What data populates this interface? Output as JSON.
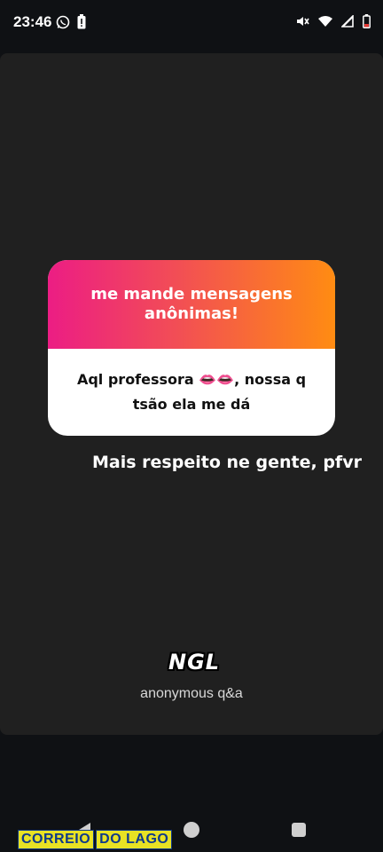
{
  "status_bar": {
    "time": "23:46",
    "left_icons": [
      "whatsapp-icon",
      "battery-alert-icon"
    ],
    "right_icons": [
      "mute-icon",
      "wifi-icon",
      "signal-icon",
      "battery-icon"
    ]
  },
  "story": {
    "card": {
      "header": "me mande mensagens anônimas!",
      "message": "Aql professora 👄👄, nossa q tsão ela me dá"
    },
    "caption": "Mais respeito ne gente, pfvr",
    "logo": "NGL",
    "subtitle": "anonymous q&a"
  },
  "nav_bar": {
    "buttons": [
      "back-icon",
      "home-icon",
      "recents-icon"
    ]
  },
  "watermark": {
    "part1": "CORREIO",
    "part2": "DO LAGO"
  },
  "colors": {
    "gradient_start": "#ec1d84",
    "gradient_end": "#ff8c12",
    "card_background": "#202020"
  }
}
